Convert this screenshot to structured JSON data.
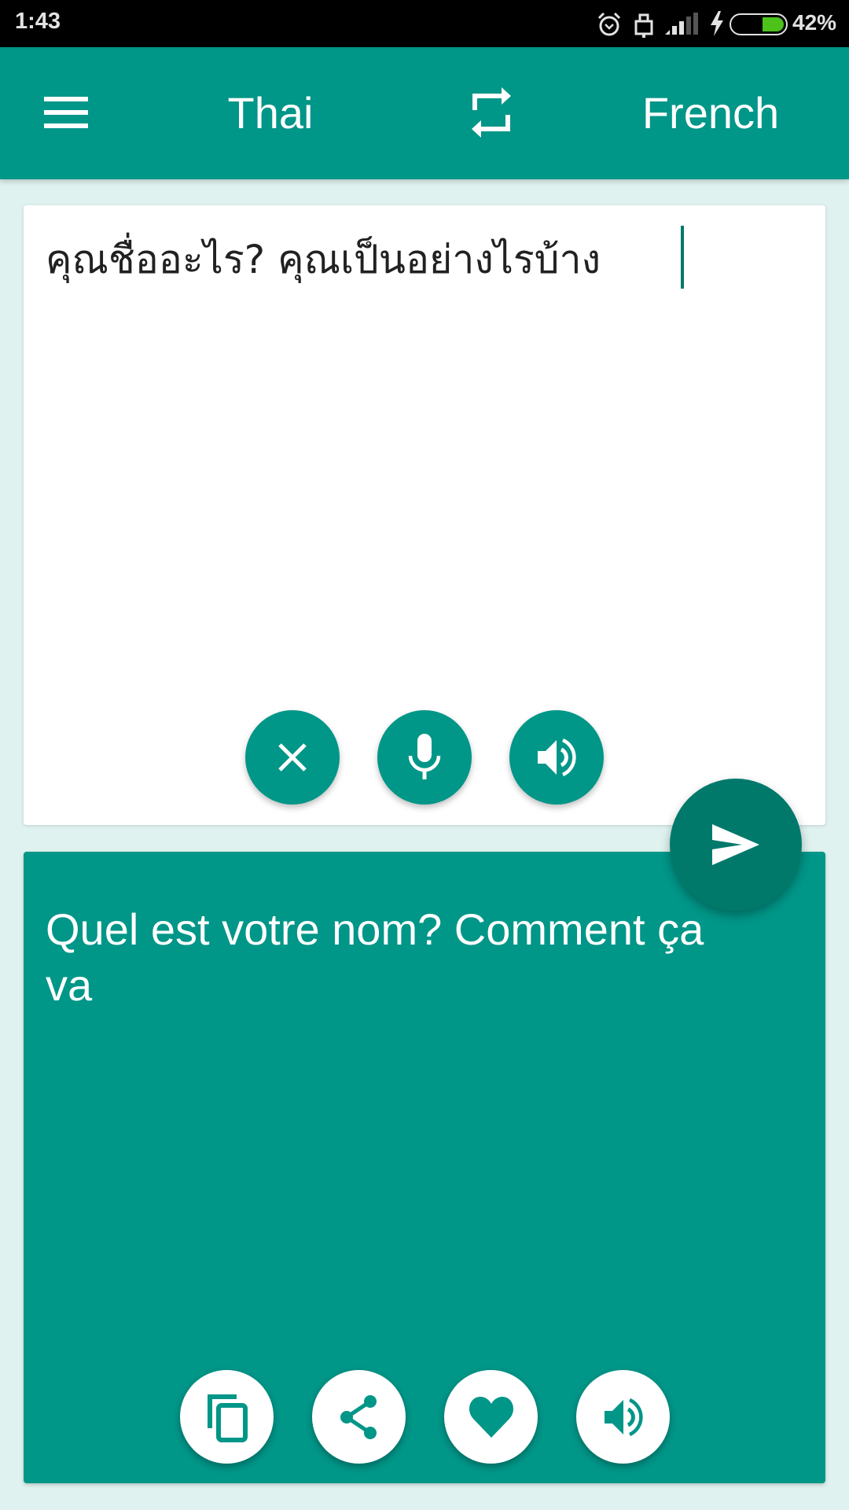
{
  "status_bar": {
    "time": "1:43",
    "icons": [
      "alarm-icon",
      "lock-icon",
      "signal-icon",
      "charging-icon",
      "battery-icon"
    ],
    "battery_percent": "42%",
    "battery_level": 0.42,
    "battery_color": "#4cc21b"
  },
  "app_bar": {
    "menu_icon": "hamburger-menu-icon",
    "source_language": "Thai",
    "swap_icon": "swap-languages-icon",
    "target_language": "French",
    "color": "#009688"
  },
  "source_panel": {
    "input_text": "คุณชื่ออะไร? คุณเป็นอย่างไรบ้าง",
    "buttons": [
      {
        "name": "clear",
        "icon": "close-icon"
      },
      {
        "name": "voice-input",
        "icon": "microphone-icon"
      },
      {
        "name": "speak-source",
        "icon": "volume-icon"
      }
    ]
  },
  "translate_button": {
    "icon": "send-icon",
    "color": "#00796b"
  },
  "target_panel": {
    "translated_text": "Quel est votre nom? Comment ça va",
    "buttons": [
      {
        "name": "copy",
        "icon": "copy-icon"
      },
      {
        "name": "share",
        "icon": "share-icon"
      },
      {
        "name": "favorite",
        "icon": "heart-icon"
      },
      {
        "name": "speak-target",
        "icon": "volume-icon"
      }
    ]
  },
  "colors": {
    "accent": "#009688",
    "accent_dark": "#00796b",
    "background": "#dff2ef",
    "card": "#ffffff"
  }
}
